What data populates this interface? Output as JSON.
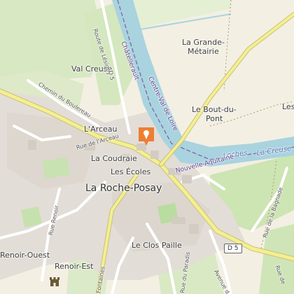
{
  "places": {
    "la_grande_metairie_1": "La Grande-",
    "la_grande_metairie_2": "Métairie",
    "val_creuse": "Val Creuse",
    "le_bout_du_pont_1": "Le Bout-du-",
    "le_bout_du_pont_2": "Pont",
    "les_edge": "Les",
    "larceau": "L'Arceau",
    "la_coudraie": "La Coudraie",
    "les_ecoles": "Les Écoles",
    "la_roche_posay": "La Roche-Posay",
    "le_clos_paille": "Le Clos Paille",
    "renoir_ouest": "Renoir-Ouest",
    "renoir_est": "Renoir-Est"
  },
  "roads": {
    "route_de_lesigny": "Route de Lésigny",
    "d5_north": "D 5",
    "chemin_du_boulereau": "Chemin du Boulereau",
    "rue_de_larceau": "Rue de l'Arceau",
    "rue_renoir": "Rue Renoir",
    "rue_de_la_bagnade": "Rue de la Bagnade",
    "rue_du_paradis": "Rue du Paradis",
    "avenue": "Avenue d",
    "fontaines": "Fontaines",
    "rue_right_edge": "Rue de"
  },
  "route_shield": "D 5",
  "water": {
    "loches": "Loches",
    "la_creuse": "La Creuse"
  },
  "boundaries": {
    "chatellerault": "Châtellerault",
    "centre_val_de_loire": "Centre-Val de Loire",
    "nouvelle_aquitaine": "Nouvelle-Aquitaine"
  },
  "icons": {
    "marker": "location-pin-icon",
    "castle": "castle-icon"
  },
  "colors": {
    "river": "#a9d3df",
    "major_road": "#f4ef8f",
    "vegetation": "#d9eac4",
    "urban": "#e0dbd4",
    "marker": "#ee7e32"
  }
}
